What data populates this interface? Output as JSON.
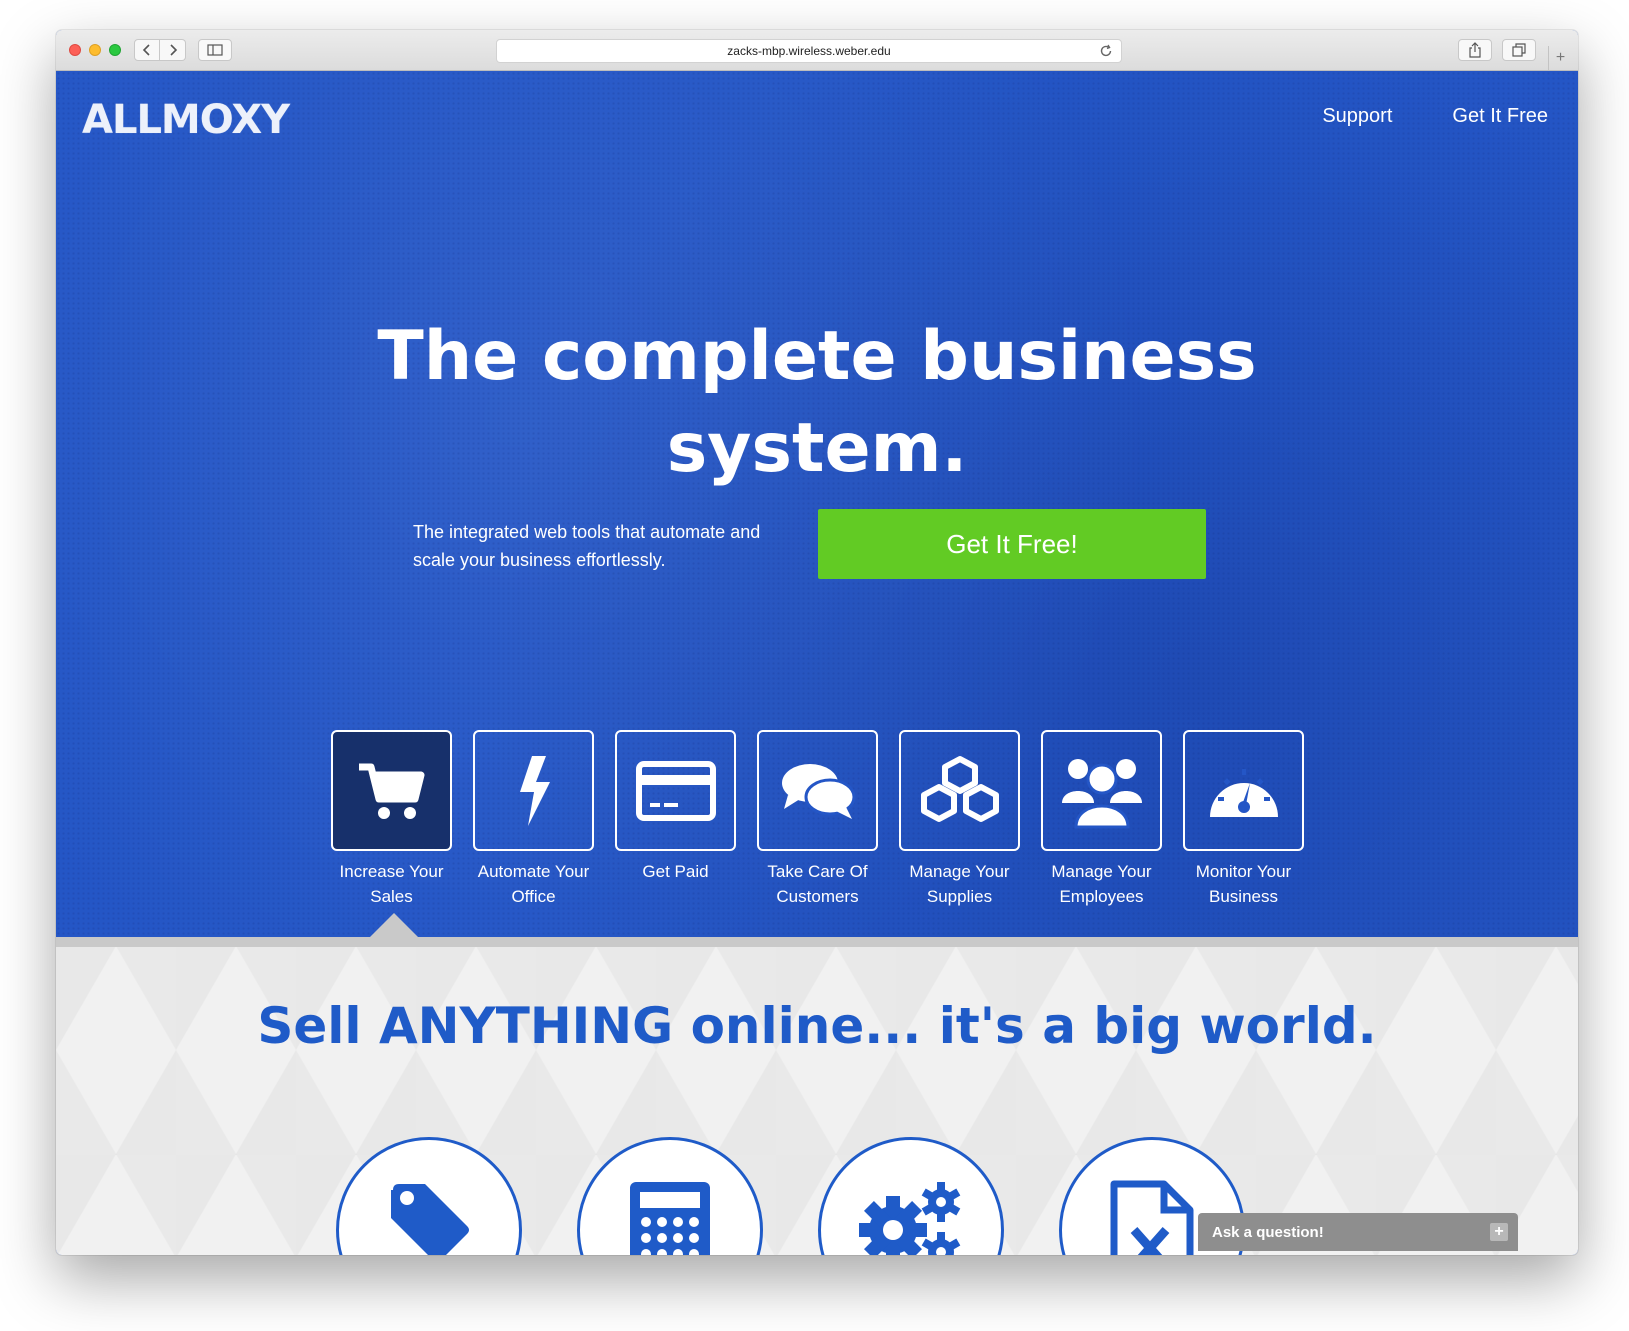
{
  "browser": {
    "url": "zacks-mbp.wireless.weber.edu"
  },
  "header": {
    "logo_text": "ALLMOXY",
    "nav": [
      {
        "label": "Support"
      },
      {
        "label": "Get It Free"
      }
    ]
  },
  "hero": {
    "headline_line1": "The complete business",
    "headline_line2": "system.",
    "subline": "The integrated web tools that automate and scale your business effortlessly.",
    "cta_label": "Get It Free!"
  },
  "features": [
    {
      "icon": "cart-icon",
      "label": "Increase Your Sales",
      "active": true
    },
    {
      "icon": "bolt-icon",
      "label": "Automate Your Office",
      "active": false
    },
    {
      "icon": "credit-card-icon",
      "label": "Get Paid",
      "active": false
    },
    {
      "icon": "chat-bubbles-icon",
      "label": "Take Care Of Customers",
      "active": false
    },
    {
      "icon": "boxes-icon",
      "label": "Manage Your Supplies",
      "active": false
    },
    {
      "icon": "users-icon",
      "label": "Manage Your Employees",
      "active": false
    },
    {
      "icon": "dashboard-icon",
      "label": "Monitor Your Business",
      "active": false
    }
  ],
  "section": {
    "title": "Sell ANYTHING online... it's a big world.",
    "circle_icons": [
      "tag-icon",
      "calculator-icon",
      "gears-icon",
      "excel-file-icon"
    ]
  },
  "chat": {
    "label": "Ask a question!",
    "plus": "+"
  },
  "colors": {
    "hero_blue": "#2456c6",
    "cta_green": "#62cb24",
    "title_blue": "#1f5bc8"
  }
}
